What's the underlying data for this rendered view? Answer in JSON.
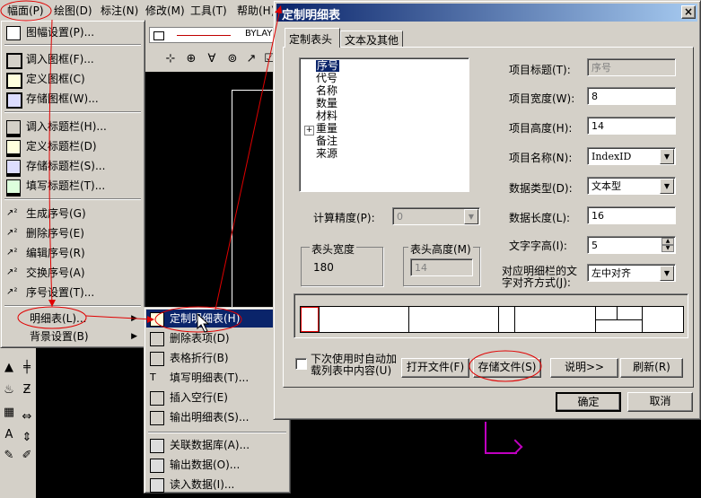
{
  "menubar": [
    "幅面(P)",
    "绘图(D)",
    "标注(N)",
    "修改(M)",
    "工具(T)",
    "帮助(H)"
  ],
  "toolbar_layer": "BYLAY",
  "menu1": {
    "items": [
      {
        "label": "图幅设置(P)..."
      },
      {
        "label": "调入图框(F)..."
      },
      {
        "label": "定义图框(C)"
      },
      {
        "label": "存储图框(W)..."
      },
      {
        "label": "调入标题栏(H)..."
      },
      {
        "label": "定义标题栏(D)"
      },
      {
        "label": "存储标题栏(S)..."
      },
      {
        "label": "填写标题栏(T)..."
      },
      {
        "label": "生成序号(G)"
      },
      {
        "label": "删除序号(E)"
      },
      {
        "label": "编辑序号(R)"
      },
      {
        "label": "交换序号(A)"
      },
      {
        "label": "序号设置(T)..."
      },
      {
        "label": "明细表(L)..."
      },
      {
        "label": "背景设置(B)"
      }
    ]
  },
  "menu2": {
    "items": [
      {
        "label": "定制明细表(H)"
      },
      {
        "label": "删除表项(D)"
      },
      {
        "label": "表格折行(B)"
      },
      {
        "label": "填写明细表(T)..."
      },
      {
        "label": "插入空行(E)"
      },
      {
        "label": "输出明细表(S)..."
      },
      {
        "label": "关联数据库(A)..."
      },
      {
        "label": "输出数据(O)..."
      },
      {
        "label": "读入数据(I)..."
      }
    ]
  },
  "dialog": {
    "title": "定制明细表",
    "close": "×",
    "tabs": [
      "定制表头",
      "文本及其他"
    ],
    "tree": [
      "序号",
      "代号",
      "名称",
      "数量",
      "材料",
      "重量",
      "备注",
      "来源"
    ],
    "tree_expander": "+",
    "calc_precision_label": "计算精度(P):",
    "calc_precision_value": "0",
    "header_width_label": "表头宽度",
    "header_width_value": "180",
    "header_height_label": "表头高度(M)",
    "header_height_value": "14",
    "fields": {
      "item_title_label": "项目标题(T):",
      "item_title_value": "序号",
      "item_width_label": "项目宽度(W):",
      "item_width_value": "8",
      "item_height_label": "项目高度(H):",
      "item_height_value": "14",
      "item_name_label": "项目名称(N):",
      "item_name_value": "IndexID",
      "data_type_label": "数据类型(D):",
      "data_type_value": "文本型",
      "data_length_label": "数据长度(L):",
      "data_length_value": "16",
      "text_height_label": "文字字高(I):",
      "text_height_value": "5",
      "align_label_1": "对应明细栏的文",
      "align_label_2": "字对齐方式(J):",
      "align_value": "左中对齐"
    },
    "checkbox_label_1": "下次使用时自动加",
    "checkbox_label_2": "载列表中内容(U)",
    "buttons": {
      "open": "打开文件(F)",
      "save": "存储文件(S)",
      "explain": "说明>>",
      "refresh": "刷新(R)",
      "ok": "确定",
      "cancel": "取消"
    }
  }
}
